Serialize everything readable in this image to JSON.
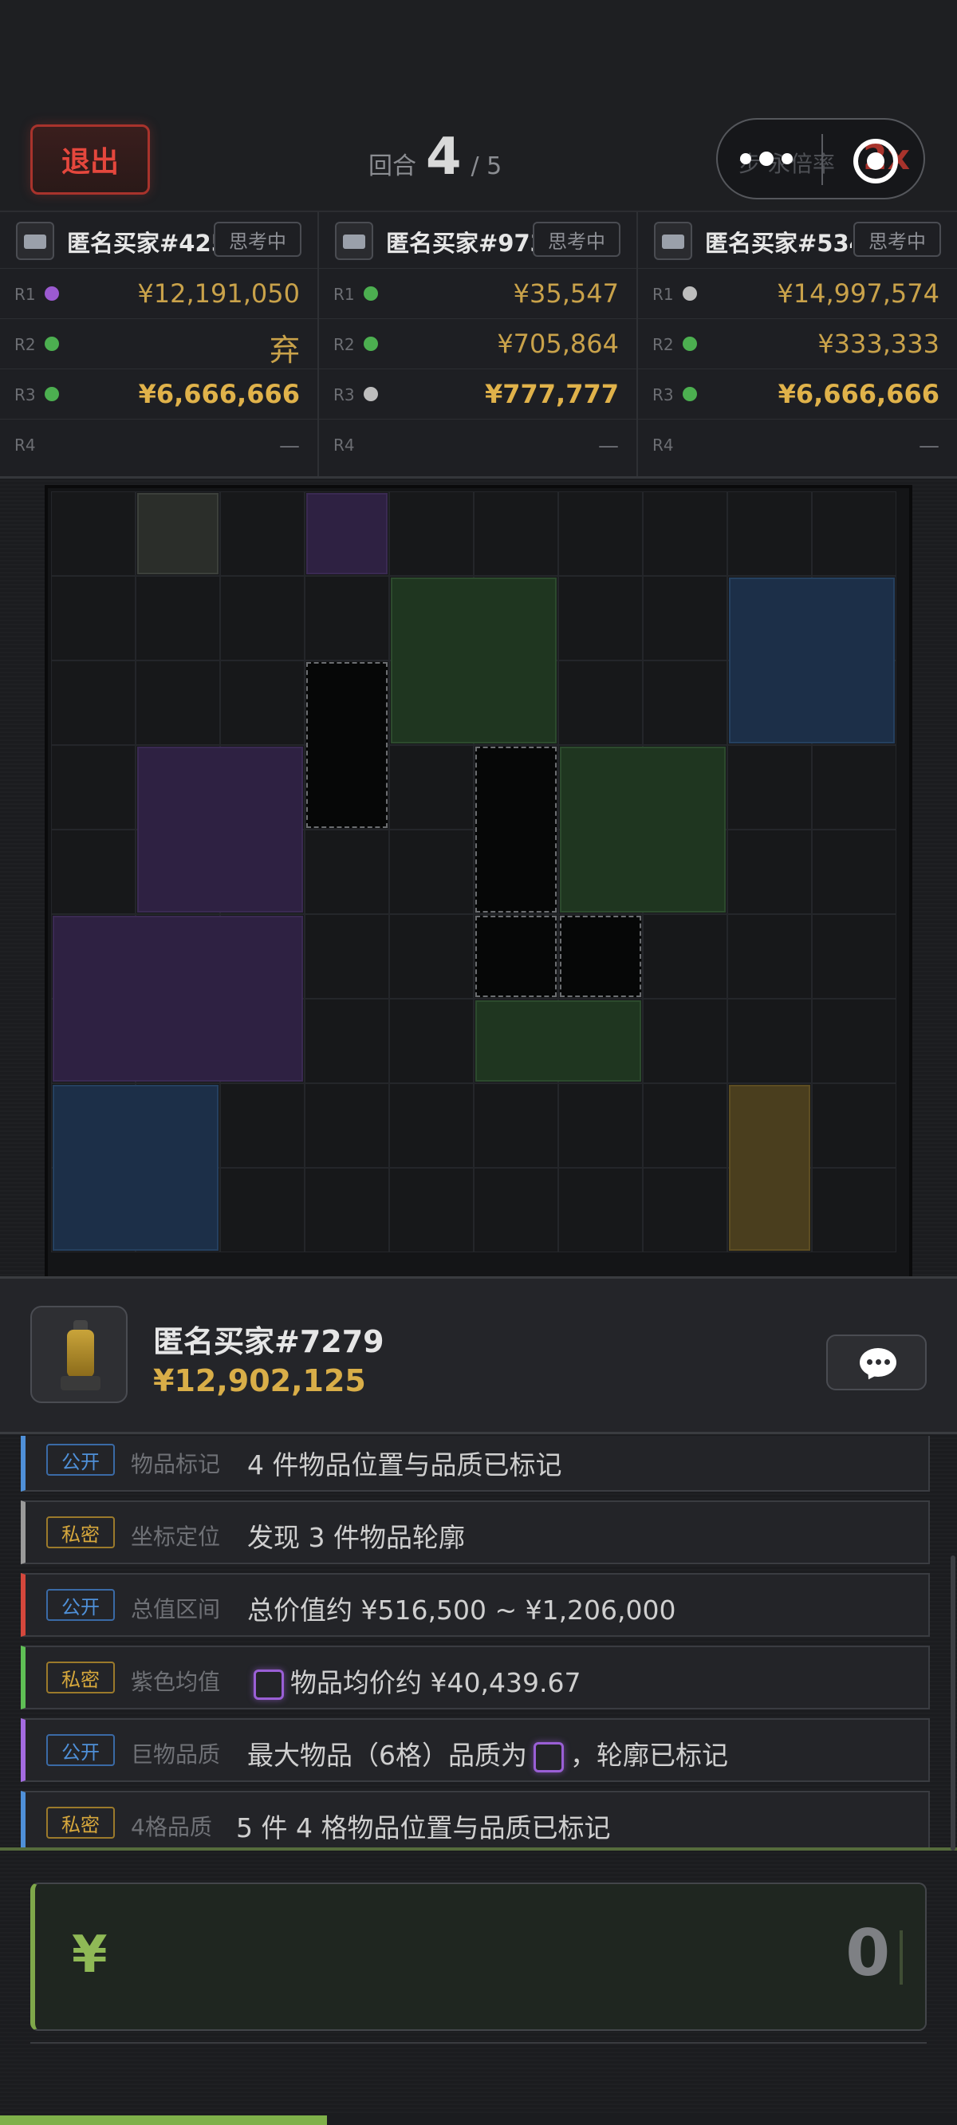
{
  "topbar": {
    "exit_label": "退出",
    "round_label": "回合",
    "round_current": "4",
    "round_total": "/ 5",
    "multiplier_label": "步·永倍率",
    "multiplier_value": "2x"
  },
  "bidders": [
    {
      "name": "匿名买家#425",
      "status": "思考中",
      "rows": [
        {
          "round": "R1",
          "dot": "#9b5ad0",
          "amount": "¥12,191,050",
          "style": "normal"
        },
        {
          "round": "R2",
          "dot": "#4caf50",
          "amount": "弃",
          "style": "fold"
        },
        {
          "round": "R3",
          "dot": "#4caf50",
          "amount": "¥6,666,666",
          "style": "big"
        },
        {
          "round": "R4",
          "dot": "",
          "amount": "—",
          "style": "empty"
        }
      ]
    },
    {
      "name": "匿名买家#973",
      "status": "思考中",
      "rows": [
        {
          "round": "R1",
          "dot": "#4caf50",
          "amount": "¥35,547",
          "style": "normal"
        },
        {
          "round": "R2",
          "dot": "#4caf50",
          "amount": "¥705,864",
          "style": "normal"
        },
        {
          "round": "R3",
          "dot": "#bdbdbd",
          "amount": "¥777,777",
          "style": "big"
        },
        {
          "round": "R4",
          "dot": "",
          "amount": "—",
          "style": "empty"
        }
      ]
    },
    {
      "name": "匿名买家#534",
      "status": "思考中",
      "rows": [
        {
          "round": "R1",
          "dot": "#bdbdbd",
          "amount": "¥14,997,574",
          "style": "normal"
        },
        {
          "round": "R2",
          "dot": "#4caf50",
          "amount": "¥333,333",
          "style": "normal"
        },
        {
          "round": "R3",
          "dot": "#4caf50",
          "amount": "¥6,666,666",
          "style": "big"
        },
        {
          "round": "R4",
          "dot": "",
          "amount": "—",
          "style": "empty"
        }
      ]
    }
  ],
  "grid": {
    "cols": 10,
    "rows": 9,
    "items": [
      {
        "col": 1,
        "row": 0,
        "w": 1,
        "h": 1,
        "kind": "gray"
      },
      {
        "col": 3,
        "row": 0,
        "w": 1,
        "h": 1,
        "kind": "purple"
      },
      {
        "col": 4,
        "row": 1,
        "w": 2,
        "h": 2,
        "kind": "green"
      },
      {
        "col": 8,
        "row": 1,
        "w": 2,
        "h": 2,
        "kind": "blue"
      },
      {
        "col": 3,
        "row": 2,
        "w": 1,
        "h": 2,
        "kind": "outline"
      },
      {
        "col": 1,
        "row": 3,
        "w": 2,
        "h": 2,
        "kind": "purple"
      },
      {
        "col": 5,
        "row": 3,
        "w": 1,
        "h": 2,
        "kind": "outline"
      },
      {
        "col": 6,
        "row": 3,
        "w": 2,
        "h": 2,
        "kind": "green"
      },
      {
        "col": 0,
        "row": 5,
        "w": 3,
        "h": 2,
        "kind": "purple"
      },
      {
        "col": 5,
        "row": 5,
        "w": 1,
        "h": 1,
        "kind": "outline"
      },
      {
        "col": 6,
        "row": 5,
        "w": 1,
        "h": 1,
        "kind": "outline"
      },
      {
        "col": 5,
        "row": 6,
        "w": 2,
        "h": 1,
        "kind": "green"
      },
      {
        "col": 0,
        "row": 7,
        "w": 2,
        "h": 2,
        "kind": "blue"
      },
      {
        "col": 8,
        "row": 7,
        "w": 1,
        "h": 2,
        "kind": "gold"
      }
    ]
  },
  "player": {
    "name": "匿名买家#7279",
    "money": "¥12,902,125"
  },
  "clues": [
    {
      "tag": "公开",
      "tag_kind": "pub",
      "border": "#4f90d8",
      "type": "物品标记",
      "text_before": "4 件物品位置与品质已标记",
      "icon": false,
      "text_after": ""
    },
    {
      "tag": "私密",
      "tag_kind": "pri",
      "border": "#9a9a9a",
      "type": "坐标定位",
      "text_before": "发现 3 件物品轮廓",
      "icon": false,
      "text_after": ""
    },
    {
      "tag": "公开",
      "tag_kind": "pub",
      "border": "#d4473c",
      "type": "总值区间",
      "text_before": "总价值约 ¥516,500 ~ ¥1,206,000",
      "icon": false,
      "text_after": ""
    },
    {
      "tag": "私密",
      "tag_kind": "pri",
      "border": "#5fbf55",
      "type": "紫色均值",
      "text_before": "",
      "icon": true,
      "text_after": "物品均价约 ¥40,439.67"
    },
    {
      "tag": "公开",
      "tag_kind": "pub",
      "border": "#a36be0",
      "type": "巨物品质",
      "text_before": "最大物品（6格）品质为",
      "icon": true,
      "text_after": "，轮廓已标记"
    },
    {
      "tag": "私密",
      "tag_kind": "pri",
      "border": "#4f90d8",
      "type": "4格品质",
      "text_before": "5 件 4 格物品位置与品质已标记",
      "icon": false,
      "text_after": ""
    }
  ],
  "bid": {
    "currency": "¥",
    "value": "0"
  },
  "progress": {
    "fraction": 0.57
  }
}
